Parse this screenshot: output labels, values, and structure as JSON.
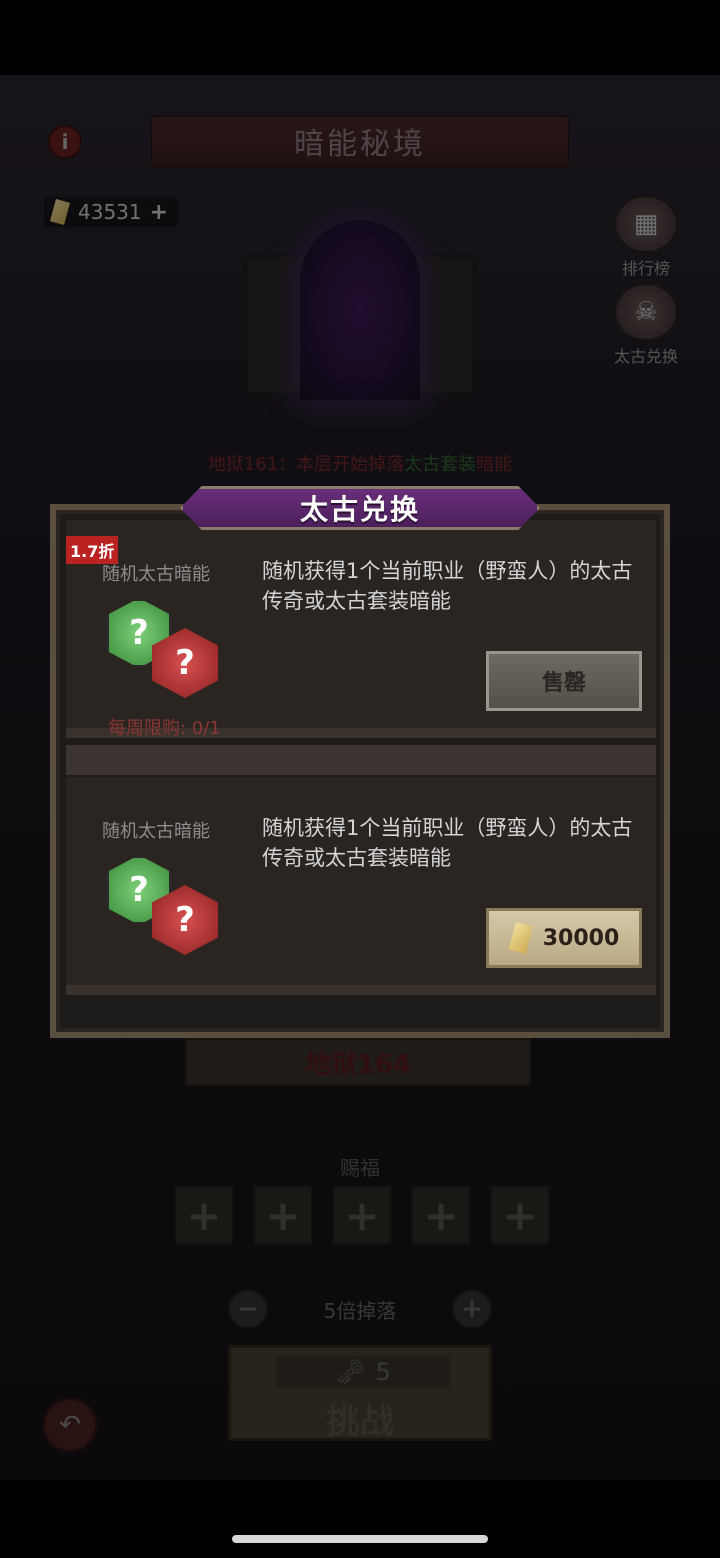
{
  "header": {
    "title": "暗能秘境",
    "info_icon": "i",
    "currency_value": "43531",
    "currency_plus": "+"
  },
  "side_buttons": {
    "ranking": "排行榜",
    "exchange": "太古兑换"
  },
  "hell_notice": {
    "prefix": "地狱161：本层开始掉落",
    "highlight": "太古套装",
    "suffix": "暗能"
  },
  "modal": {
    "title": "太古兑换",
    "items": [
      {
        "discount": "1.7折",
        "name": "随机太古暗能",
        "description": "随机获得1个当前职业（野蛮人）的太古传奇或太古套装暗能",
        "limit": "每周限购: 0/1",
        "button": "售罄"
      },
      {
        "name": "随机太古暗能",
        "description": "随机获得1个当前职业（野蛮人）的太古传奇或太古套装暗能",
        "price": "30000"
      }
    ]
  },
  "level": {
    "label": "地狱164"
  },
  "blessing": {
    "label": "赐福",
    "slot_symbol": "+"
  },
  "multiplier": {
    "minus": "−",
    "text": "5倍掉落",
    "plus": "+"
  },
  "challenge": {
    "cost": "5",
    "label": "挑战"
  },
  "colors": {
    "accent_purple": "#6a2f7a",
    "price_button": "#d6c8a8",
    "discount_red": "#b22222"
  }
}
